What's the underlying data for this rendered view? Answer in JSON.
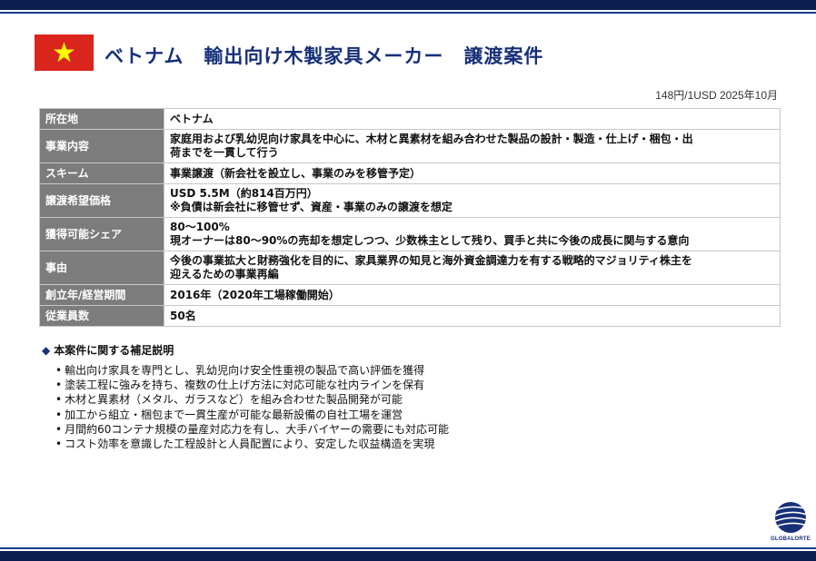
{
  "header": {
    "title": "ベトナム　輸出向け木製家具メーカー　譲渡案件",
    "exchange_rate": "148円/1USD 2025年10月"
  },
  "table": {
    "rows": [
      {
        "label": "所在地",
        "lines": [
          "ベトナム"
        ]
      },
      {
        "label": "事業内容",
        "lines": [
          "家庭用および乳幼児向け家具を中心に、木材と異素材を組み合わせた製品の設計・製造・仕上げ・梱包・出",
          "荷までを一貫して行う"
        ]
      },
      {
        "label": "スキーム",
        "lines": [
          "事業譲渡（新会社を設立し、事業のみを移管予定）"
        ]
      },
      {
        "label": "譲渡希望価格",
        "lines": [
          "USD 5.5M（約814百万円）",
          "※負債は新会社に移管せず、資産・事業のみの譲渡を想定"
        ]
      },
      {
        "label": "獲得可能シェア",
        "lines": [
          "80～100%",
          "現オーナーは80～90%の売却を想定しつつ、少数株主として残り、買手と共に今後の成長に関与する意向"
        ]
      },
      {
        "label": "事由",
        "lines": [
          "今後の事業拡大と財務強化を目的に、家具業界の知見と海外資金調達力を有する戦略的マジョリティ株主を",
          "迎えるための事業再編"
        ]
      },
      {
        "label": "創立年/経営期間",
        "lines": [
          "2016年（2020年工場稼働開始）"
        ]
      },
      {
        "label": "従業員数",
        "lines": [
          "50名"
        ]
      }
    ]
  },
  "supplement": {
    "heading": "本案件に関する補足説明",
    "bullets": [
      "輸出向け家具を専門とし、乳幼児向け安全性重視の製品で高い評価を獲得",
      "塗装工程に強みを持ち、複数の仕上げ方法に対応可能な社内ラインを保有",
      "木材と異素材（メタル、ガラスなど）を組み合わせた製品開発が可能",
      "加工から組立・梱包まで一貫生産が可能な最新設備の自社工場を運営",
      "月間約60コンテナ規模の量産対応力を有し、大手バイヤーの需要にも対応可能",
      "コスト効率を意識した工程設計と人員配置により、安定した収益構造を実現"
    ]
  },
  "logo": {
    "text": "GLOBALORTE",
    "icon": "globe-logo-icon"
  },
  "flag": {
    "icon": "vietnam-flag-icon"
  },
  "colors": {
    "navy": "#0d1e52",
    "title_blue": "#17307a",
    "label_gray": "#7c7c7c",
    "flag_red": "#da251d",
    "star_yellow": "#ffff00"
  }
}
